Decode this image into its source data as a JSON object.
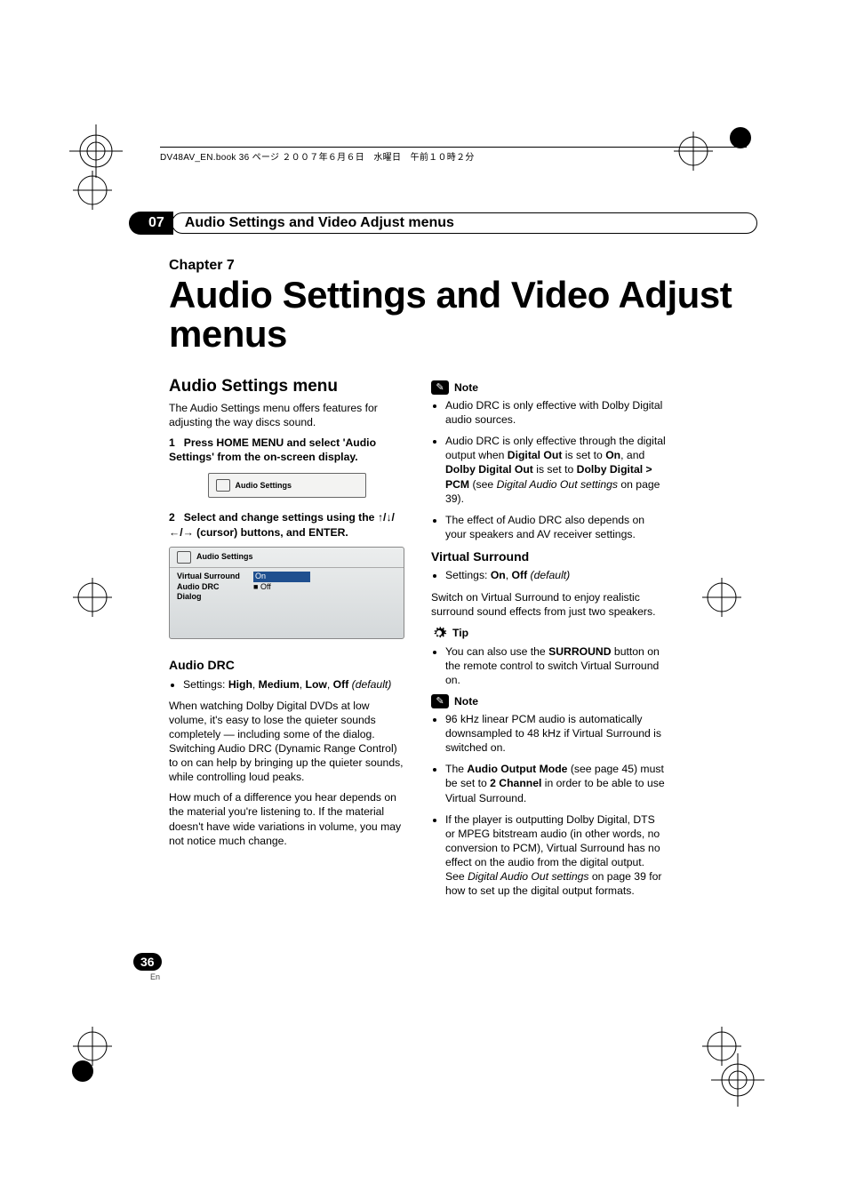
{
  "header_strip": "DV48AV_EN.book  36 ページ  ２００７年６月６日　水曜日　午前１０時２分",
  "chapter_badge": "07",
  "section_title": "Audio Settings and Video Adjust menus",
  "chapter_label": "Chapter 7",
  "main_title": "Audio Settings and Video Adjust menus",
  "left": {
    "h2": "Audio Settings menu",
    "intro": "The Audio Settings menu offers features for adjusting the way discs sound.",
    "step1_num": "1",
    "step1": "Press HOME MENU and select 'Audio Settings' from the on-screen display.",
    "uibox_label": "Audio Settings",
    "step2_num": "2",
    "step2a": "Select and change settings using the ",
    "step2b": " (cursor) buttons, and ENTER.",
    "table_title": "Audio Settings",
    "rows": [
      {
        "l": "Virtual Surround",
        "r": "On"
      },
      {
        "l": "Audio DRC",
        "r": "Off"
      },
      {
        "l": "Dialog",
        "r": ""
      }
    ],
    "drc_h": "Audio DRC",
    "drc_set_pre": "Settings: ",
    "drc_set_b1": "High",
    "drc_set_s1": ", ",
    "drc_set_b2": "Medium",
    "drc_set_s2": ", ",
    "drc_set_b3": "Low",
    "drc_set_s3": ", ",
    "drc_set_b4": "Off",
    "drc_set_i": " (default)",
    "drc_p1": "When watching Dolby Digital DVDs at low volume, it's easy to lose the quieter sounds completely — including some of the dialog. Switching Audio DRC (Dynamic Range Control) to on can help by bringing up the quieter sounds, while controlling loud peaks.",
    "drc_p2": "How much of a difference you hear depends on the material you're listening to. If the material doesn't have wide variations in volume, you may not notice much change."
  },
  "right": {
    "note1_label": "Note",
    "note1_b1": "Audio DRC is only effective with Dolby Digital audio sources.",
    "note1_b2a": "Audio DRC is only effective through the digital output when ",
    "note1_b2b": "Digital Out",
    "note1_b2c": " is set to ",
    "note1_b2d": "On",
    "note1_b2e": ", and ",
    "note1_b2f": "Dolby Digital Out",
    "note1_b2g": " is set to ",
    "note1_b2h": "Dolby Digital > PCM",
    "note1_b2i": " (see ",
    "note1_b2j": "Digital Audio Out settings",
    "note1_b2k": " on page 39).",
    "note1_b3": "The effect of Audio DRC also depends on your speakers and AV receiver settings.",
    "vs_h": "Virtual Surround",
    "vs_set_pre": "Settings: ",
    "vs_set_b1": "On",
    "vs_set_s1": ", ",
    "vs_set_b2": "Off",
    "vs_set_i": " (default)",
    "vs_p": "Switch on Virtual Surround to enjoy realistic surround sound effects from just two speakers.",
    "tip_label": "Tip",
    "tip_b1a": "You can also use the ",
    "tip_b1b": "SURROUND",
    "tip_b1c": " button on the remote control to switch Virtual Surround on.",
    "note2_label": "Note",
    "note2_b1": "96 kHz linear PCM audio is automatically downsampled to 48 kHz if Virtual Surround is switched on.",
    "note2_b2a": "The ",
    "note2_b2b": "Audio Output Mode",
    "note2_b2c": " (see page 45) must be set to ",
    "note2_b2d": "2 Channel",
    "note2_b2e": " in order to be able to use Virtual Surround.",
    "note2_b3a": "If the player is outputting Dolby Digital, DTS or MPEG bitstream audio (in other words, no conversion to PCM), Virtual Surround has no effect on the audio from the digital output. See ",
    "note2_b3b": "Digital Audio Out settings",
    "note2_b3c": " on page 39 for how to set up the digital output formats."
  },
  "footer": {
    "page": "36",
    "lang": "En"
  }
}
